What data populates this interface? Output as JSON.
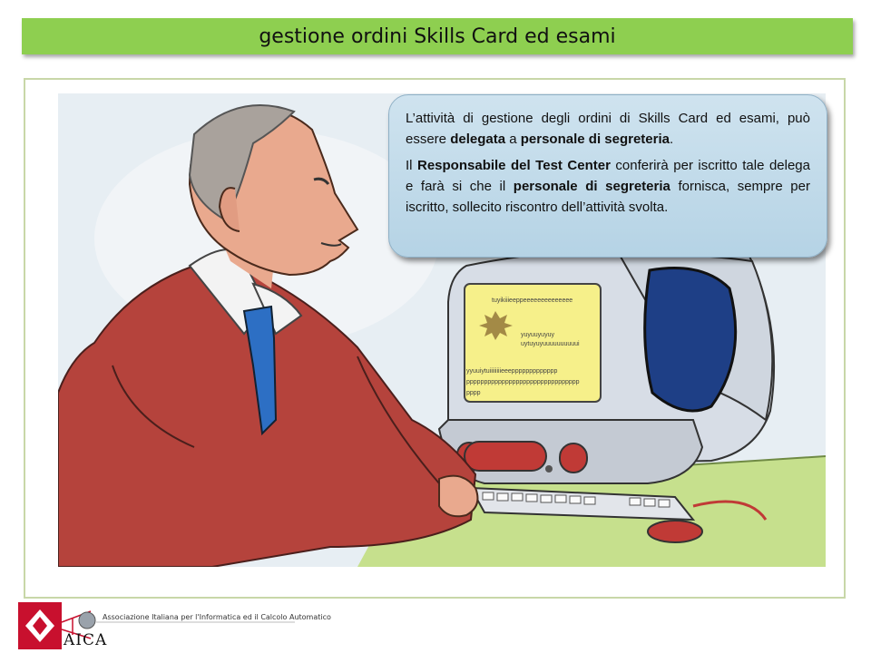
{
  "title": "gestione ordini Skills Card ed esami",
  "bubble": {
    "p1_a": "L’attività di gestione degli ordini di Skills Card ed esami, può essere ",
    "p1_b": "delegata",
    "p1_c": " a ",
    "p1_d": "personale di segreteria",
    "p1_e": ".",
    "p2_a": "Il ",
    "p2_b": "Responsabile del Test Center",
    "p2_c": " conferirà per iscritto tale delega e farà si che il ",
    "p2_d": "personale di segreteria",
    "p2_e": " fornisca, sempre per iscritto, sollecito riscontro dell’attività svolta."
  },
  "screen_text": {
    "line1": "tuyikiiieeppeeeeeeeeeeeeee",
    "line2": "yuyuuyuyuy",
    "line3": "uytuyuyuuuuuuuuuui",
    "line4": "yyuuiytuiiiiiiiieeeppppppppppppp",
    "line5": "pppppppppppppppppppppppppppppppp",
    "line6": "pppp"
  },
  "footer": {
    "association": "Associazione Italiana per l'Informatica ed il Calcolo Automatico",
    "brand": "AICA"
  },
  "colors": {
    "title_bar": "#8ecf50",
    "jacket": "#b5433c",
    "tie": "#2d6fc4",
    "screen": "#f6f08a",
    "bubble": "#c4dcea"
  }
}
